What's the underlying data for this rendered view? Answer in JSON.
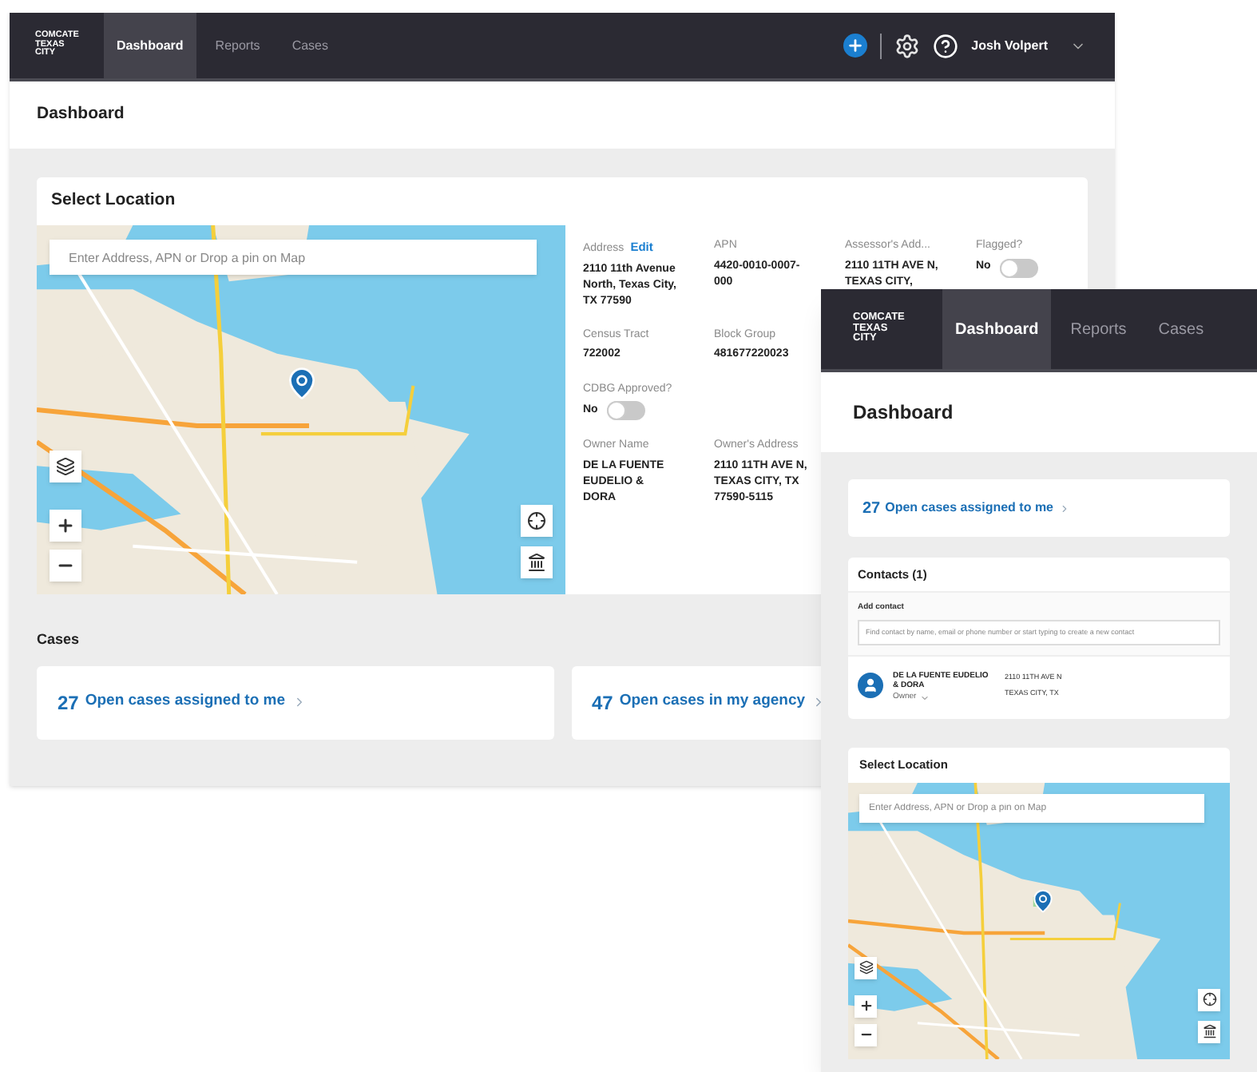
{
  "desktop": {
    "nav": {
      "logo": [
        "COMCATE",
        "TEXAS",
        "CITY"
      ],
      "tabs": [
        {
          "label": "Dashboard",
          "selected": true
        },
        {
          "label": "Reports",
          "selected": false
        },
        {
          "label": "Cases",
          "selected": false
        }
      ],
      "user": "Josh Volpert"
    },
    "page_title": "Dashboard",
    "select_location": {
      "title": "Select Location",
      "search": {
        "placeholder": "Enter Address, APN or Drop a pin on Map"
      },
      "rows": [
        [
          {
            "kind": "text",
            "label": "Address",
            "link": "Edit",
            "value": "2110 11th Avenue North, Texas City, TX 77590"
          },
          {
            "kind": "text",
            "label": "APN",
            "value": "4420-0010-0007-000"
          },
          {
            "kind": "text",
            "label": "Assessor's Add...",
            "value": "2110 11TH AVE N, TEXAS CITY,"
          },
          {
            "kind": "toggle",
            "label": "Flagged?",
            "value": "No",
            "on": false
          }
        ],
        [
          {
            "kind": "text",
            "label": "Census Tract",
            "value": "722002"
          },
          {
            "kind": "text",
            "label": "Block Group",
            "value": "481677220023"
          }
        ],
        [
          {
            "kind": "toggle",
            "label": "CDBG Approved?",
            "value": "No",
            "on": false
          }
        ],
        [
          {
            "kind": "text",
            "label": "Owner Name",
            "value": "DE LA FUENTE EUDELIO & DORA"
          },
          {
            "kind": "text",
            "label": "Owner's Address",
            "value": "2110 11TH AVE N, TEXAS CITY, TX 77590-5115"
          }
        ]
      ]
    },
    "cases": {
      "title": "Cases",
      "cards": [
        {
          "count": "27",
          "label": "Open cases assigned to me"
        },
        {
          "count": "47",
          "label": "Open cases in my agency"
        }
      ]
    }
  },
  "mobile": {
    "nav": {
      "logo": [
        "COMCATE",
        "TEXAS",
        "CITY"
      ],
      "tabs": [
        {
          "label": "Dashboard",
          "selected": true
        },
        {
          "label": "Reports",
          "selected": false
        },
        {
          "label": "Cases",
          "selected": false
        }
      ]
    },
    "page_title": "Dashboard",
    "cases_card": {
      "count": "27",
      "label": "Open cases assigned to me"
    },
    "contacts": {
      "title": "Contacts (1)",
      "add_label": "Add contact",
      "search": {
        "placeholder": "Find contact by name, email or phone number or start typing to create a new contact"
      },
      "items": [
        {
          "name": "DE LA FUENTE EUDELIO & DORA",
          "role": "Owner",
          "address": [
            "2110 11TH AVE N",
            "TEXAS CITY, TX"
          ]
        }
      ]
    },
    "select_location": {
      "title": "Select Location",
      "search": {
        "placeholder": "Enter Address, APN or Drop a pin on Map"
      }
    }
  }
}
